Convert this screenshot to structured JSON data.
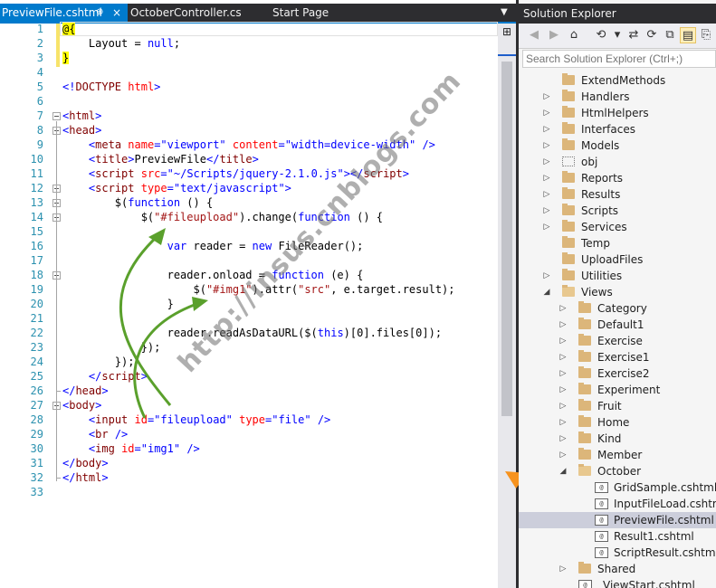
{
  "editor": {
    "tabs": [
      {
        "label": "PreviewFile.cshtml",
        "pin": "⊕",
        "close": "×"
      },
      {
        "label": "OctoberController.cs"
      },
      {
        "label": "Start Page"
      }
    ],
    "tab_dropdown": "▼",
    "split_icon": "⊞",
    "line_numbers": [
      "1",
      "2",
      "3",
      "4",
      "5",
      "6",
      "7",
      "8",
      "9",
      "10",
      "11",
      "12",
      "13",
      "14",
      "15",
      "16",
      "17",
      "18",
      "19",
      "20",
      "21",
      "22",
      "23",
      "24",
      "25",
      "26",
      "27",
      "28",
      "29",
      "30",
      "31",
      "32",
      "33"
    ],
    "watermark": "http://insus.cnblogs.com"
  },
  "explorer": {
    "title": "Solution Explorer",
    "search_placeholder": "Search Solution Explorer (Ctrl+;)",
    "toolbar": [
      "◀",
      "▶",
      "⌂",
      "⟲",
      "▾",
      "⇄",
      "⟳",
      "⧉",
      "▤",
      "⎘"
    ],
    "items": [
      {
        "label": "ExtendMethods",
        "type": "folder",
        "level": 0,
        "state": "none"
      },
      {
        "label": "Handlers",
        "type": "folder",
        "level": 0,
        "state": "collapsed"
      },
      {
        "label": "HtmlHelpers",
        "type": "folder",
        "level": 0,
        "state": "collapsed"
      },
      {
        "label": "Interfaces",
        "type": "folder",
        "level": 0,
        "state": "collapsed"
      },
      {
        "label": "Models",
        "type": "folder",
        "level": 0,
        "state": "collapsed"
      },
      {
        "label": "obj",
        "type": "dotted",
        "level": 0,
        "state": "collapsed"
      },
      {
        "label": "Reports",
        "type": "folder",
        "level": 0,
        "state": "collapsed"
      },
      {
        "label": "Results",
        "type": "folder",
        "level": 0,
        "state": "collapsed"
      },
      {
        "label": "Scripts",
        "type": "folder",
        "level": 0,
        "state": "collapsed"
      },
      {
        "label": "Services",
        "type": "folder",
        "level": 0,
        "state": "collapsed"
      },
      {
        "label": "Temp",
        "type": "folder",
        "level": 0,
        "state": "none"
      },
      {
        "label": "UploadFiles",
        "type": "folder",
        "level": 0,
        "state": "none"
      },
      {
        "label": "Utilities",
        "type": "folder",
        "level": 0,
        "state": "collapsed"
      },
      {
        "label": "Views",
        "type": "open",
        "level": 0,
        "state": "expanded"
      },
      {
        "label": "Category",
        "type": "folder",
        "level": 1,
        "state": "collapsed"
      },
      {
        "label": "Default1",
        "type": "folder",
        "level": 1,
        "state": "collapsed"
      },
      {
        "label": "Exercise",
        "type": "folder",
        "level": 1,
        "state": "collapsed"
      },
      {
        "label": "Exercise1",
        "type": "folder",
        "level": 1,
        "state": "collapsed"
      },
      {
        "label": "Exercise2",
        "type": "folder",
        "level": 1,
        "state": "collapsed"
      },
      {
        "label": "Experiment",
        "type": "folder",
        "level": 1,
        "state": "collapsed"
      },
      {
        "label": "Fruit",
        "type": "folder",
        "level": 1,
        "state": "collapsed"
      },
      {
        "label": "Home",
        "type": "folder",
        "level": 1,
        "state": "collapsed"
      },
      {
        "label": "Kind",
        "type": "folder",
        "level": 1,
        "state": "collapsed"
      },
      {
        "label": "Member",
        "type": "folder",
        "level": 1,
        "state": "collapsed"
      },
      {
        "label": "October",
        "type": "open",
        "level": 1,
        "state": "expanded"
      },
      {
        "label": "GridSample.cshtml",
        "type": "cshtml",
        "level": 2,
        "state": "none"
      },
      {
        "label": "InputFileLoad.cshtml",
        "type": "cshtml",
        "level": 2,
        "state": "none"
      },
      {
        "label": "PreviewFile.cshtml",
        "type": "cshtml",
        "level": 2,
        "state": "none",
        "selected": true
      },
      {
        "label": "Result1.cshtml",
        "type": "cshtml",
        "level": 2,
        "state": "none"
      },
      {
        "label": "ScriptResult.cshtml",
        "type": "cshtml",
        "level": 2,
        "state": "none"
      },
      {
        "label": "Shared",
        "type": "folder",
        "level": 1,
        "state": "collapsed"
      },
      {
        "label": "_ViewStart.cshtml",
        "type": "cshtml",
        "level": 1,
        "state": "none"
      }
    ]
  },
  "colors": {
    "accent": "#007acc",
    "annotation_arrow_green": "#5aa02c",
    "annotation_arrow_orange": "#f7931e",
    "razor_highlight": "#ffff00"
  }
}
